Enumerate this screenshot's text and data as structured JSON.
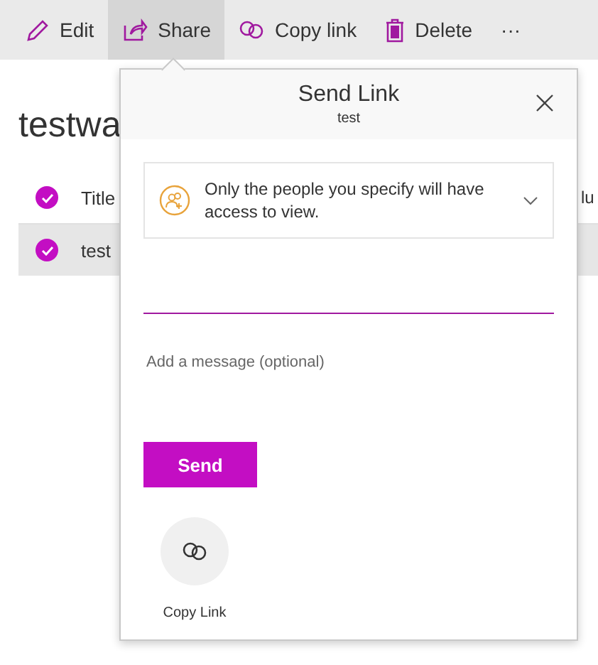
{
  "toolbar": [
    {
      "label": "Edit",
      "selected": false
    },
    {
      "label": "Share",
      "selected": true
    },
    {
      "label": "Copy link",
      "selected": false
    },
    {
      "label": "Delete",
      "selected": false
    },
    {
      "label": "···",
      "selected": false
    }
  ],
  "page": {
    "title": "testwa",
    "header": {
      "checked": true,
      "columns": [
        "Title",
        "lu"
      ]
    },
    "rows": [
      {
        "title": "test",
        "selected": true
      }
    ]
  },
  "dialog": {
    "title": "Send Link",
    "subtitle": "test",
    "permission": "Only the people you specify will have access to view.",
    "message": {
      "placeholder": "Add a message (optional)"
    },
    "send_button": "Send",
    "copy_link": "Copy Link"
  }
}
